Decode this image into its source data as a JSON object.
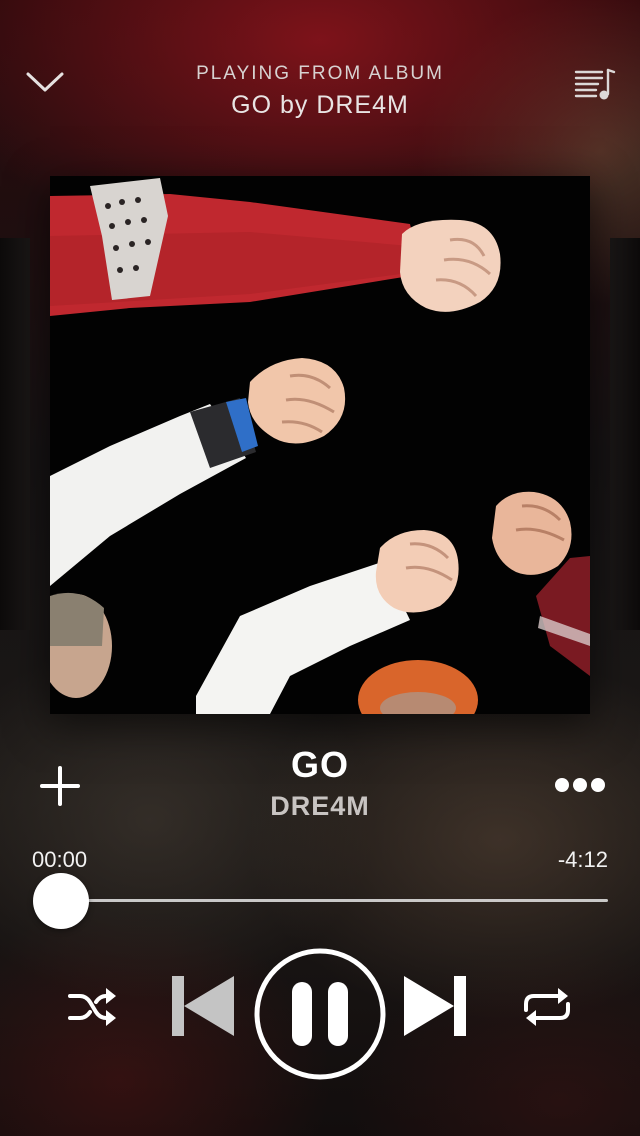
{
  "header": {
    "context_label": "PLAYING FROM ALBUM",
    "context_name": "GO by DRE4M",
    "collapse_icon": "chevron-down-icon",
    "queue_icon": "queue-list-icon"
  },
  "track": {
    "title": "GO",
    "artist": "DRE4M",
    "add_icon": "plus-icon",
    "more_icon": "more-dots-icon"
  },
  "progress": {
    "elapsed": "00:00",
    "remaining": "-4:12",
    "fraction": 0.0
  },
  "controls": {
    "shuffle_icon": "shuffle-icon",
    "previous_icon": "previous-icon",
    "play_pause_icon": "pause-icon",
    "next_icon": "next-icon",
    "repeat_icon": "repeat-icon"
  },
  "colors": {
    "accent_red": "#8c141c",
    "text_primary": "#ffffff",
    "text_secondary": "#c8c4c2"
  }
}
